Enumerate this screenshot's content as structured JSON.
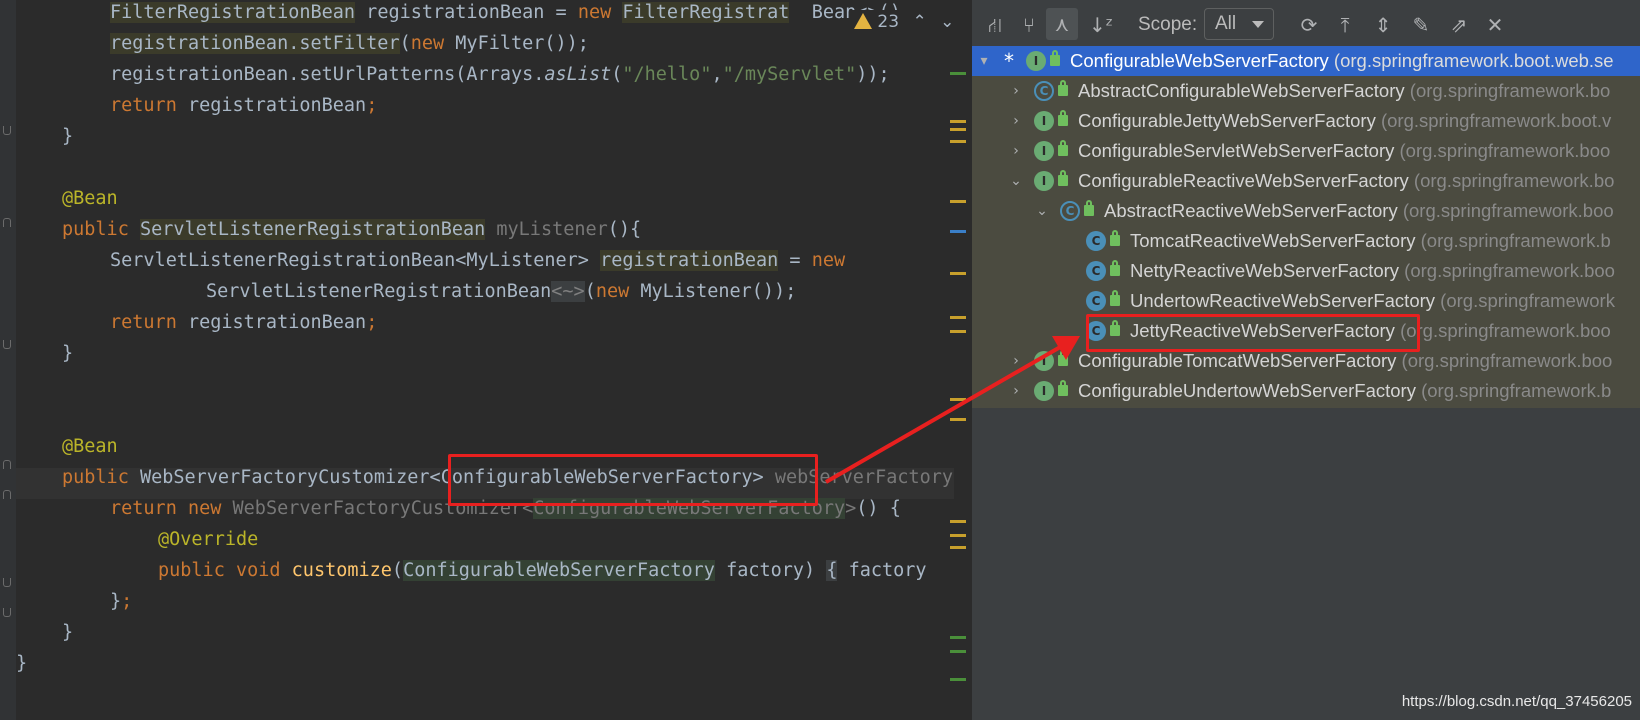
{
  "editor": {
    "warning_count": "23",
    "lines": [
      {
        "segs": [
          {
            "t": "FilterRegistrationBean",
            "c": "hl-olive"
          },
          {
            "t": " registrationBean = "
          },
          {
            "t": "new",
            "c": "kw"
          },
          {
            "t": " "
          },
          {
            "t": "FilterRegistrat",
            "c": "hl-olive"
          },
          {
            "t": "  Bean<>()"
          }
        ]
      },
      {
        "segs": [
          {
            "t": "registrationBean.setFilter",
            "c": "hl-olive"
          },
          {
            "t": "("
          },
          {
            "t": "new",
            "c": "kw"
          },
          {
            "t": " MyFilter());"
          }
        ]
      },
      {
        "segs": [
          {
            "t": "registrationBean.setUrlPatterns(Arrays."
          },
          {
            "t": "asList",
            "c": "it"
          },
          {
            "t": "("
          },
          {
            "t": "\"/hello\"",
            "c": "str"
          },
          {
            "t": ","
          },
          {
            "t": "\"/myServlet\"",
            "c": "str"
          },
          {
            "t": "));"
          }
        ]
      },
      {
        "segs": [
          {
            "t": "return",
            "c": "kw"
          },
          {
            "t": " registrationBean"
          },
          {
            "t": ";",
            "c": "kw"
          }
        ]
      },
      {
        "segs": [
          {
            "t": "}"
          }
        ]
      },
      {
        "segs": []
      },
      {
        "segs": [
          {
            "t": "@Bean",
            "c": "ann"
          }
        ]
      },
      {
        "segs": [
          {
            "t": "public",
            "c": "kw"
          },
          {
            "t": " "
          },
          {
            "t": "ServletListenerRegistrationBean",
            "c": "hl-olive"
          },
          {
            "t": " "
          },
          {
            "t": "myListener",
            "c": "dim"
          },
          {
            "t": "(){"
          }
        ]
      },
      {
        "segs": [
          {
            "t": "ServletListenerRegistrationBean<MyListener> "
          },
          {
            "t": "registrationBean",
            "c": "hl-olive"
          },
          {
            "t": " = "
          },
          {
            "t": "new",
            "c": "kw"
          }
        ]
      },
      {
        "segs": [
          {
            "t": "ServletListenerRegistrationBean"
          },
          {
            "t": "<~>",
            "c": "hl-gray gray"
          },
          {
            "t": "("
          },
          {
            "t": "new",
            "c": "kw"
          },
          {
            "t": " MyListener());"
          }
        ]
      },
      {
        "segs": [
          {
            "t": "return",
            "c": "kw"
          },
          {
            "t": " registrationBean"
          },
          {
            "t": ";",
            "c": "kw"
          }
        ]
      },
      {
        "segs": [
          {
            "t": "}"
          }
        ]
      },
      {
        "segs": []
      },
      {
        "segs": []
      },
      {
        "segs": [
          {
            "t": "@Bean",
            "c": "ann"
          }
        ]
      },
      {
        "segs": [
          {
            "t": "public",
            "c": "kw"
          },
          {
            "t": " WebServerFactoryCustomizer<ConfigurableWebServerFactory> "
          },
          {
            "t": "webServerFactoryCustomizer",
            "c": "dim"
          }
        ]
      },
      {
        "segs": [
          {
            "t": "return",
            "c": "kw"
          },
          {
            "t": " "
          },
          {
            "t": "new",
            "c": "kw"
          },
          {
            "t": " "
          },
          {
            "t": "WebServerFactoryCustomizer<",
            "c": "dim"
          },
          {
            "t": "ConfigurableWebServerFactory",
            "c": "hl-green dim"
          },
          {
            "t": ">",
            "c": "dim"
          },
          {
            "t": "() {"
          }
        ]
      },
      {
        "segs": [
          {
            "t": "@Override",
            "c": "ann"
          }
        ]
      },
      {
        "segs": [
          {
            "t": "public",
            "c": "kw"
          },
          {
            "t": " "
          },
          {
            "t": "void",
            "c": "kw"
          },
          {
            "t": " "
          },
          {
            "t": "customize",
            "c": "fn"
          },
          {
            "t": "("
          },
          {
            "t": "ConfigurableWebServerFactory",
            "c": "hl-green"
          },
          {
            "t": " factory) "
          },
          {
            "t": "{",
            "c": "hl-gray"
          },
          {
            "t": " factory"
          }
        ]
      },
      {
        "segs": [
          {
            "t": "}"
          },
          {
            "t": ";",
            "c": "kw"
          }
        ]
      },
      {
        "segs": [
          {
            "t": "}"
          }
        ]
      },
      {
        "segs": [
          {
            "t": "}"
          }
        ]
      }
    ]
  },
  "hierarchy": {
    "scope_label": "Scope:",
    "scope_value": "All",
    "toolbar_icons": [
      "type-hierarchy-icon",
      "supertypes-icon",
      "subtypes-icon",
      "sort-alpha-icon",
      "refresh-icon",
      "export-icon",
      "expand-all-icon",
      "pin-icon",
      "open-in-window-icon",
      "close-icon"
    ],
    "toolbar_glyphs": [
      "⛙",
      "⑂",
      "⋏",
      "↓ᶻ",
      "⟳",
      "⤒",
      "⇕",
      "✎",
      "⇗",
      "✕"
    ],
    "rows": [
      {
        "name": "ConfigurableWebServerFactory",
        "pkg": "(org.springframework.boot.web.se",
        "kind": "I",
        "arrow": "▾",
        "star": "*",
        "selected": true
      },
      {
        "name": "AbstractConfigurableWebServerFactory",
        "pkg": "(org.springframework.bo",
        "kind": "AC",
        "arrow": "›"
      },
      {
        "name": "ConfigurableJettyWebServerFactory",
        "pkg": "(org.springframework.boot.v",
        "kind": "I",
        "arrow": "›"
      },
      {
        "name": "ConfigurableServletWebServerFactory",
        "pkg": "(org.springframework.boo",
        "kind": "I",
        "arrow": "›"
      },
      {
        "name": "ConfigurableReactiveWebServerFactory",
        "pkg": "(org.springframework.bo",
        "kind": "I",
        "arrow": "⌄"
      },
      {
        "name": "AbstractReactiveWebServerFactory",
        "pkg": "(org.springframework.boo",
        "kind": "AC",
        "arrow": "⌄"
      },
      {
        "name": "TomcatReactiveWebServerFactory",
        "pkg": "(org.springframework.b",
        "kind": "C"
      },
      {
        "name": "NettyReactiveWebServerFactory",
        "pkg": "(org.springframework.boo",
        "kind": "C"
      },
      {
        "name": "UndertowReactiveWebServerFactory",
        "pkg": "(org.springframework",
        "kind": "C"
      },
      {
        "name": "JettyReactiveWebServerFactory",
        "pkg": "(org.springframework.boo",
        "kind": "C"
      },
      {
        "name": "ConfigurableTomcatWebServerFactory",
        "pkg": "(org.springframework.boo",
        "kind": "I",
        "arrow": "›"
      },
      {
        "name": "ConfigurableUndertowWebServerFactory",
        "pkg": "(org.springframework.b",
        "kind": "I",
        "arrow": "›"
      }
    ]
  },
  "watermark": "https://blog.csdn.net/qq_37456205",
  "colors": {
    "selection": "#2f65ca",
    "annotation_red": "#e8201f"
  }
}
